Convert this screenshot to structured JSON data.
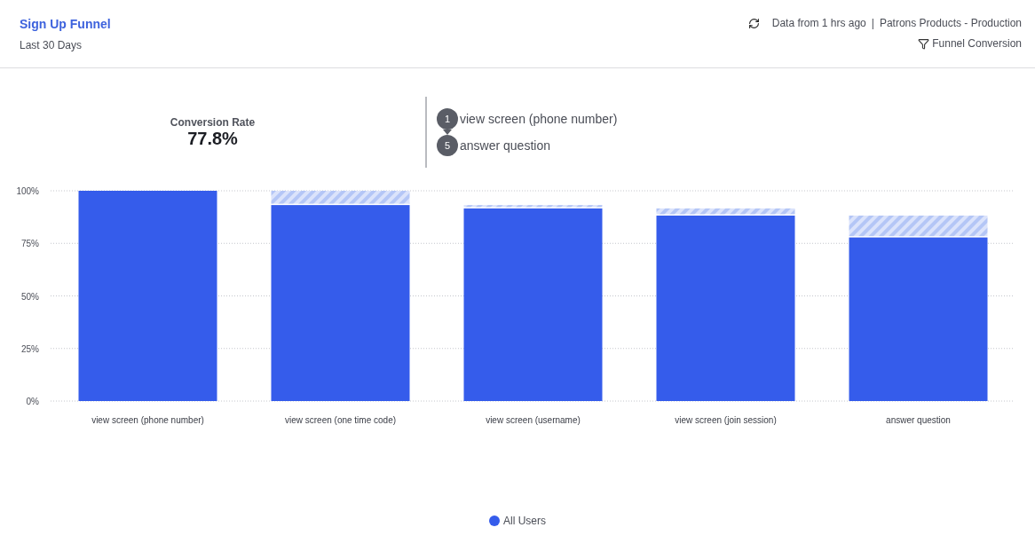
{
  "header": {
    "title": "Sign Up Funnel",
    "subtitle": "Last 30 Days",
    "status": "Data from 1 hrs ago",
    "separator": "|",
    "project": "Patrons Products - Production",
    "view": "Funnel Conversion"
  },
  "summary": {
    "label": "Conversion Rate",
    "value": "77.8%",
    "steps": [
      {
        "number": "1",
        "name": "view screen (phone number)"
      },
      {
        "number": "5",
        "name": "answer question"
      }
    ]
  },
  "chart_data": {
    "type": "bar",
    "stacked": true,
    "grid": true,
    "categories": [
      "view screen (phone number)",
      "view screen (one time code)",
      "view screen (username)",
      "view screen (join session)",
      "answer question"
    ],
    "ylim": [
      0,
      100
    ],
    "yticks": [
      {
        "value": 0,
        "label": "0%"
      },
      {
        "value": 25,
        "label": "25%"
      },
      {
        "value": 50,
        "label": "50%"
      },
      {
        "value": 75,
        "label": "75%"
      },
      {
        "value": 100,
        "label": "100%"
      }
    ],
    "series": [
      {
        "name": "All Users",
        "color": "#355ceb",
        "values": [
          100,
          93.2,
          91.6,
          88.2,
          77.8
        ]
      },
      {
        "color": "#b4c6f6",
        "values": [
          null,
          6.8,
          1.6,
          3.4,
          10.4
        ]
      }
    ]
  }
}
